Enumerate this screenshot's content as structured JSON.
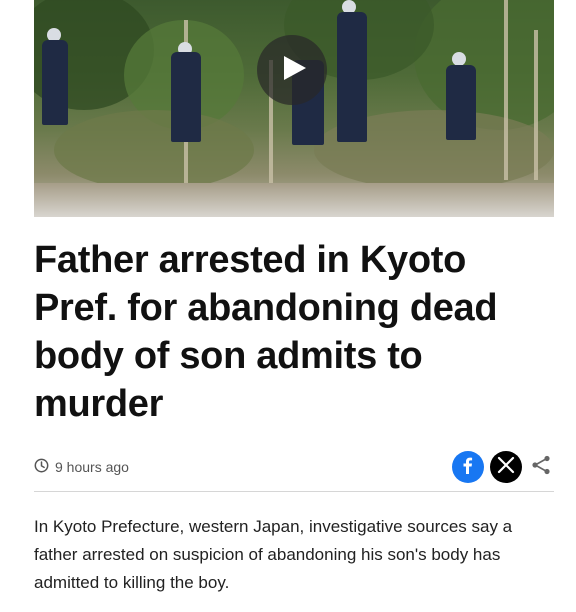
{
  "video": {
    "play_icon": "play-icon",
    "thumbnail": "police officers in forest"
  },
  "article": {
    "headline": "Father arrested in Kyoto Pref. for abandoning dead body of son admits to murder",
    "timestamp": "9 hours ago",
    "body": "In Kyoto Prefecture, western Japan, investigative sources say a father arrested on suspicion of abandoning his son's body has admitted to killing the boy."
  },
  "share": {
    "icons": [
      "facebook-icon",
      "x-icon",
      "share-icon"
    ]
  },
  "colors": {
    "facebook": "#1877f2",
    "x": "#000000",
    "text": "#111111",
    "muted": "#555555"
  }
}
